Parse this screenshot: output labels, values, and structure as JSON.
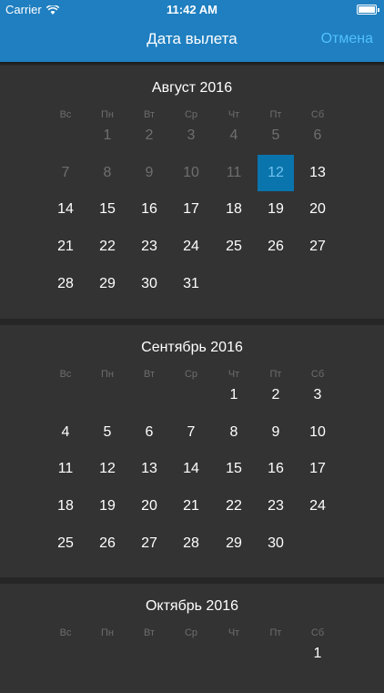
{
  "status_bar": {
    "carrier": "Carrier",
    "time": "11:42 AM"
  },
  "nav": {
    "title": "Дата вылета",
    "cancel_label": "Отмена"
  },
  "weekdays": [
    "Вс",
    "Пн",
    "Вт",
    "Ср",
    "Чт",
    "Пт",
    "Сб"
  ],
  "months": [
    {
      "title": "Август 2016",
      "weeks": [
        [
          null,
          "1",
          "2",
          "3",
          "4",
          "5",
          "6"
        ],
        [
          "7",
          "8",
          "9",
          "10",
          "11",
          "12",
          "13"
        ],
        [
          "14",
          "15",
          "16",
          "17",
          "18",
          "19",
          "20"
        ],
        [
          "21",
          "22",
          "23",
          "24",
          "25",
          "26",
          "27"
        ],
        [
          "28",
          "29",
          "30",
          "31",
          null,
          null,
          null
        ]
      ],
      "disabled_days": [
        "1",
        "2",
        "3",
        "4",
        "5",
        "6",
        "7",
        "8",
        "9",
        "10",
        "11"
      ],
      "selected_day": "12"
    },
    {
      "title": "Сентябрь 2016",
      "weeks": [
        [
          null,
          null,
          null,
          null,
          "1",
          "2",
          "3"
        ],
        [
          "4",
          "5",
          "6",
          "7",
          "8",
          "9",
          "10"
        ],
        [
          "11",
          "12",
          "13",
          "14",
          "15",
          "16",
          "17"
        ],
        [
          "18",
          "19",
          "20",
          "21",
          "22",
          "23",
          "24"
        ],
        [
          "25",
          "26",
          "27",
          "28",
          "29",
          "30",
          null
        ]
      ],
      "disabled_days": [],
      "selected_day": null
    },
    {
      "title": "Октябрь 2016",
      "weeks": [
        [
          null,
          null,
          null,
          null,
          null,
          null,
          "1"
        ]
      ],
      "disabled_days": [],
      "selected_day": null
    }
  ],
  "colors": {
    "accent": "#1f7fc0",
    "selected": "#0a74ad",
    "cancel": "#52c0ff"
  }
}
